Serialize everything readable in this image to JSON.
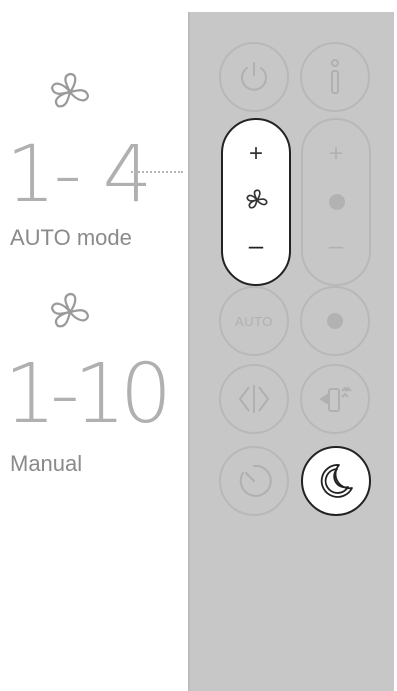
{
  "legend": {
    "auto_range": "1- 4",
    "auto_label": "AUTO mode",
    "manual_range": "1-10",
    "manual_label": "Manual"
  },
  "remote": {
    "power_icon": "power-icon",
    "info_icon": "info-icon",
    "fan_plus": "+",
    "fan_minus": "–",
    "heat_plus": "+",
    "heat_minus": "–",
    "auto_label": "AUTO",
    "oscillation_icon": "oscillation-icon",
    "airflow_icon": "airflow-direction-icon",
    "timer_icon": "timer-icon",
    "night_icon": "moon-icon"
  },
  "colors": {
    "remote_body": "#c7c7c7",
    "highlight": "#ffffff",
    "muted": "#b4b4b4"
  }
}
